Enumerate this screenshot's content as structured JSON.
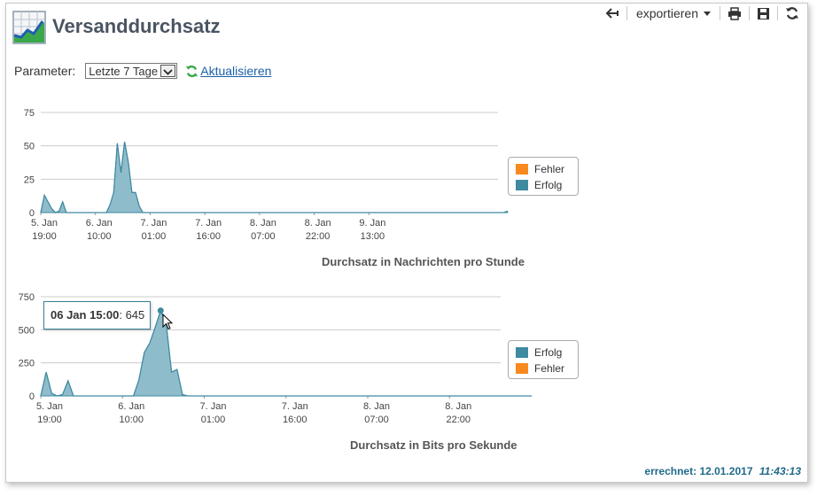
{
  "header": {
    "title": "Versanddurchsatz",
    "icon": "chart-report-icon"
  },
  "toolbar": {
    "back_icon": "back-arrow-icon",
    "export_label": "exportieren",
    "print_icon": "print-icon",
    "save_icon": "save-icon",
    "refresh_icon": "refresh-icon"
  },
  "params": {
    "label": "Parameter:",
    "selected": "Letzte 7 Tage",
    "refresh_label": "Aktualisieren"
  },
  "colors": {
    "erfolg": "#3e8aa0",
    "erfolg_fill": "#8fbccb",
    "fehler": "#f7891f",
    "link": "#1a5fa8"
  },
  "chart_data": [
    {
      "type": "area",
      "title": "Durchsatz in Nachrichten pro Stunde",
      "y_ticks": [
        "0",
        "25",
        "50",
        "75"
      ],
      "ylim": [
        0,
        75
      ],
      "x_tick_labels": [
        [
          "5. Jan",
          "19:00"
        ],
        [
          "6. Jan",
          "10:00"
        ],
        [
          "7. Jan",
          "01:00"
        ],
        [
          "7. Jan",
          "16:00"
        ],
        [
          "8. Jan",
          "07:00"
        ],
        [
          "8. Jan",
          "22:00"
        ],
        [
          "9. Jan",
          "13:00"
        ]
      ],
      "legend": [
        "Fehler",
        "Erfolg"
      ],
      "grid": true,
      "series": [
        {
          "name": "Erfolg",
          "x_hours": [
            0,
            1,
            3,
            4,
            5,
            6,
            7,
            18,
            19,
            20,
            21,
            22,
            23,
            24,
            25,
            26,
            27,
            28,
            29,
            30,
            31,
            32,
            127,
            128
          ],
          "values": [
            0,
            13,
            3,
            0,
            1,
            8,
            0,
            0,
            6,
            15,
            52,
            30,
            53,
            38,
            15,
            15,
            5,
            0,
            0,
            0,
            0,
            0,
            0,
            1
          ]
        },
        {
          "name": "Fehler",
          "x_hours": [
            0,
            128
          ],
          "values": [
            0,
            0
          ]
        }
      ]
    },
    {
      "type": "area",
      "title": "Durchsatz in Bits pro Sekunde",
      "y_ticks": [
        "0",
        "250",
        "500",
        "750"
      ],
      "ylim": [
        0,
        750
      ],
      "x_tick_labels": [
        [
          "5. Jan",
          "19:00"
        ],
        [
          "6. Jan",
          "10:00"
        ],
        [
          "7. Jan",
          "01:00"
        ],
        [
          "7. Jan",
          "16:00"
        ],
        [
          "8. Jan",
          "07:00"
        ],
        [
          "8. Jan",
          "22:00"
        ]
      ],
      "legend": [
        "Erfolg",
        "Fehler"
      ],
      "grid": true,
      "tooltip": {
        "label": "06 Jan 15:00",
        "value": "645"
      },
      "series": [
        {
          "name": "Erfolg",
          "x_hours": [
            0,
            1,
            2,
            3,
            4,
            5,
            6,
            17,
            18,
            19,
            20,
            21,
            22,
            23,
            24,
            25,
            26,
            27,
            28,
            29,
            104
          ],
          "values": [
            0,
            180,
            20,
            0,
            10,
            115,
            0,
            0,
            120,
            330,
            400,
            520,
            645,
            550,
            180,
            200,
            10,
            0,
            0,
            0,
            0
          ]
        },
        {
          "name": "Fehler",
          "x_hours": [
            0,
            104
          ],
          "values": [
            0,
            0
          ]
        }
      ]
    }
  ],
  "footer": {
    "label": "errechnet:",
    "date": "12.01.2017",
    "time": "11:43:13"
  }
}
